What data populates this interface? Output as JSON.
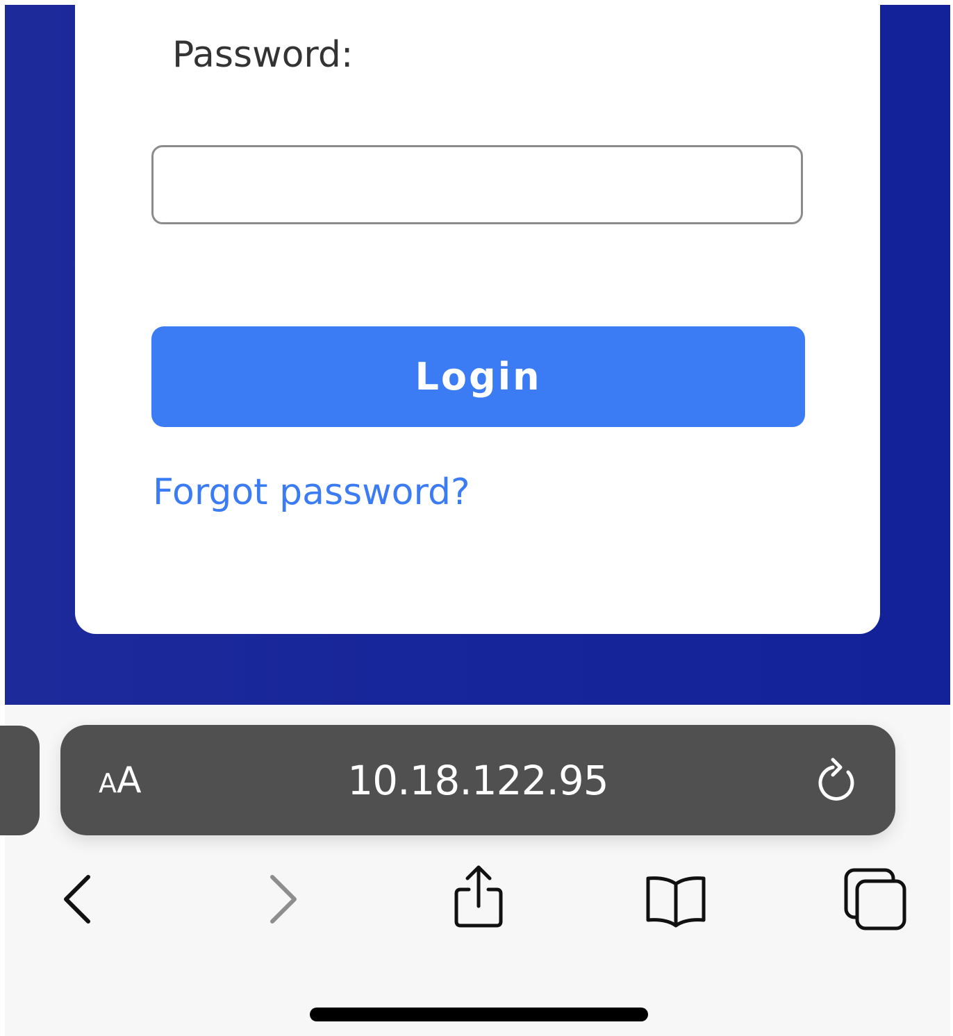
{
  "login_form": {
    "password_label": "Password:",
    "password_value": "",
    "password_placeholder": "",
    "login_label": "Login",
    "forgot_label": "Forgot password?"
  },
  "browser": {
    "text_size_small": "A",
    "text_size_large": "A",
    "url": "10.18.122.95",
    "icons": {
      "reload": "reload-icon",
      "back": "back-chevron-icon",
      "forward": "forward-chevron-icon",
      "share": "share-icon",
      "bookmarks": "bookmarks-icon",
      "tabs": "tabs-icon"
    }
  },
  "colors": {
    "page_background": "#1a279a",
    "accent": "#3b7cf4",
    "address_bar": "#505050",
    "toolbar_background": "#f7f7f7"
  }
}
